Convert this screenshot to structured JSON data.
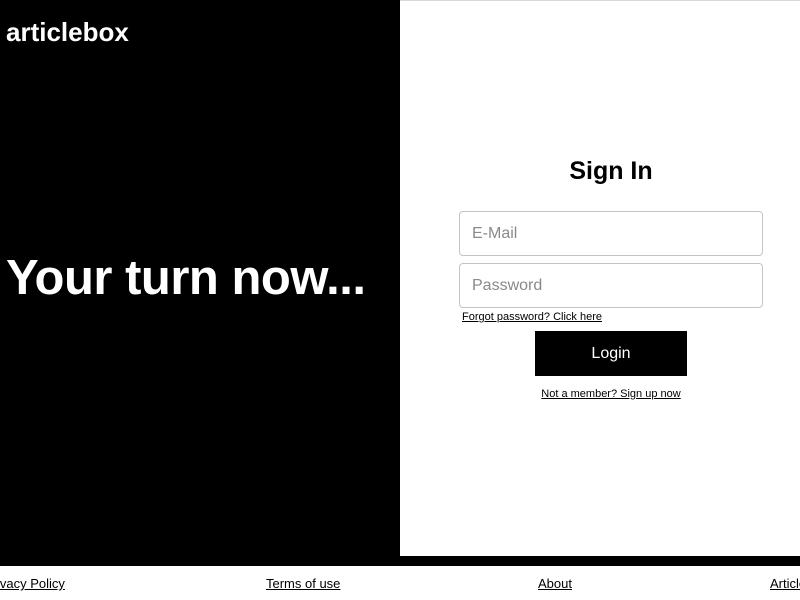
{
  "brand": {
    "name": "articlebox"
  },
  "hero": {
    "tagline": "Your turn now..."
  },
  "signin": {
    "title": "Sign In",
    "email": {
      "placeholder": "E-Mail",
      "value": ""
    },
    "password": {
      "placeholder": "Password",
      "value": ""
    },
    "forgot_label": "Forgot password? Click here",
    "login_label": "Login",
    "signup_label": "Not a member? Sign up now"
  },
  "footer": {
    "links": [
      {
        "label": "Privacy Policy"
      },
      {
        "label": "Terms of use"
      },
      {
        "label": "About"
      },
      {
        "label": "Articlebox"
      }
    ]
  },
  "colors": {
    "left_background": "#000000",
    "right_background": "#ffffff",
    "button_background": "#000000",
    "button_text": "#ffffff",
    "field_border": "#c4c4c4"
  }
}
